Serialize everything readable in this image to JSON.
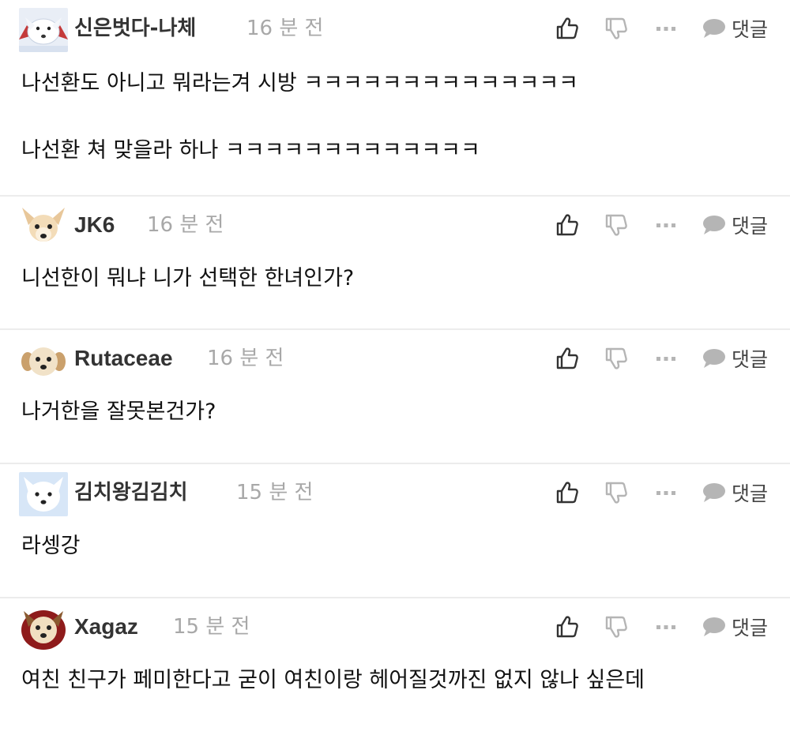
{
  "comments": [
    {
      "author": "신은벗다-나체",
      "time": "16 분 전",
      "avatar_icon": "dog-avatar-icon",
      "reply_label": "댓글",
      "lines": [
        "나선환도 아니고 뭐라는겨 시방 ㅋㅋㅋㅋㅋㅋㅋㅋㅋㅋㅋㅋㅋㅋ",
        "나선환 쳐 맞을라 하나 ㅋㅋㅋㅋㅋㅋㅋㅋㅋㅋㅋㅋㅋ"
      ]
    },
    {
      "author": "JK6",
      "time": "16 분 전",
      "avatar_icon": "dog-avatar-icon",
      "reply_label": "댓글",
      "lines": [
        "니선한이 뭐냐 니가 선택한 한녀인가?"
      ]
    },
    {
      "author": "Rutaceae",
      "time": "16 분 전",
      "avatar_icon": "dog-avatar-icon",
      "reply_label": "댓글",
      "lines": [
        "나거한을 잘못본건가?"
      ]
    },
    {
      "author": "김치왕김김치",
      "time": "15 분 전",
      "avatar_icon": "dog-avatar-icon",
      "reply_label": "댓글",
      "lines": [
        "라셍강"
      ]
    },
    {
      "author": "Xagaz",
      "time": "15 분 전",
      "avatar_icon": "dog-avatar-icon",
      "reply_label": "댓글",
      "lines": [
        "여친 친구가 페미한다고 굳이 여친이랑 헤어질것까진 없지 않나 싶은데"
      ]
    }
  ],
  "icons": {
    "like": "thumbs-up-icon",
    "dislike": "thumbs-down-icon",
    "more": "more-dots-icon",
    "reply": "speech-bubble-icon"
  },
  "colors": {
    "icon_gray": "#333333",
    "icon_light": "#b5b5b5",
    "time_gray": "#a8a8a8",
    "divider": "#ececec"
  }
}
